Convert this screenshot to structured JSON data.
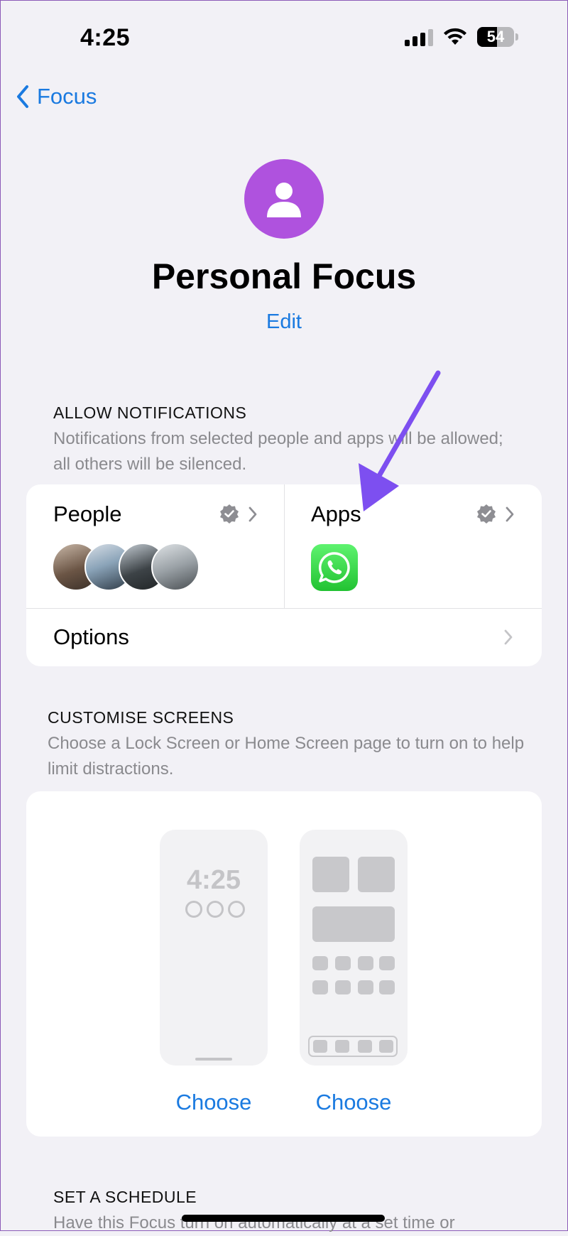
{
  "status_bar": {
    "time": "4:25",
    "battery_percent": "54",
    "battery_level": 0.54
  },
  "nav": {
    "back_label": "Focus"
  },
  "focus": {
    "title": "Personal Focus",
    "edit_label": "Edit",
    "accent_color": "#af52de"
  },
  "allow_notifications": {
    "header": "ALLOW NOTIFICATIONS",
    "description": "Notifications from selected people and apps will be allowed; all others will be silenced.",
    "people_label": "People",
    "apps_label": "Apps",
    "apps": [
      "whatsapp-icon"
    ],
    "options_label": "Options"
  },
  "customise_screens": {
    "header": "CUSTOMISE SCREENS",
    "description": "Choose a Lock Screen or Home Screen page to turn on to help limit distractions.",
    "lock_preview_time": "4:25",
    "lock_choose_label": "Choose",
    "home_choose_label": "Choose"
  },
  "schedule": {
    "header": "SET A SCHEDULE",
    "description": "Have this Focus turn on automatically at a set time or"
  },
  "colors": {
    "link_blue": "#1a7ae0",
    "annotation_arrow": "#7d4ff0",
    "background": "#f2f1f6"
  }
}
